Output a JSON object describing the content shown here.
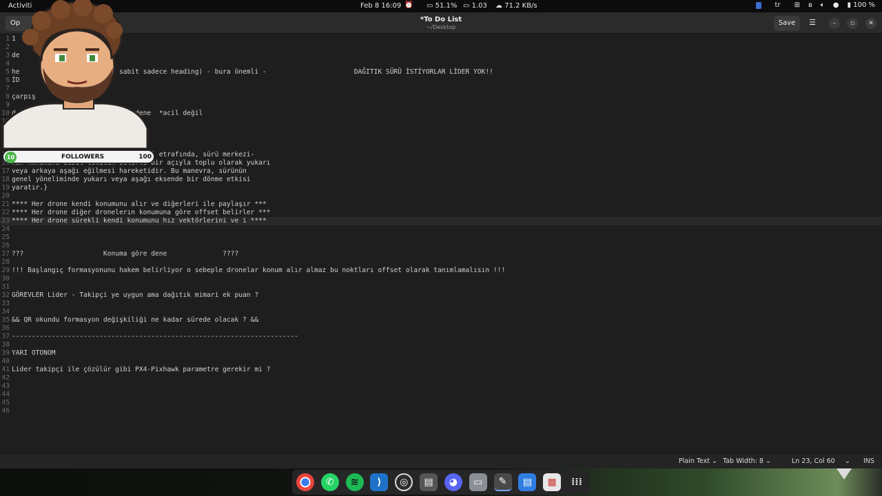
{
  "topbar": {
    "activities": "Activiti",
    "datetime": "Feb 8  16:09",
    "cpu": "51.1%",
    "load": "1.03",
    "net": "71.2 KB/s",
    "lang": "tr",
    "battery": "100 %"
  },
  "header": {
    "open_label": "Op",
    "title": "*To Do List",
    "subtitle": "~/Desktop",
    "save_label": "Save"
  },
  "overlay": {
    "followers_label": "FOLLOWERS",
    "followers_min": "10",
    "followers_max": "100"
  },
  "editor": {
    "current_line": 23,
    "lines": [
      {
        "n": "1",
        "t": "1"
      },
      {
        "n": "2",
        "t": ""
      },
      {
        "n": "3",
        "t": "de"
      },
      {
        "n": "4",
        "t": ""
      },
      {
        "n": "5",
        "t": "he                    rame sabit sadece heading) - bura önemli -                      DAĞITIK SÜRÜ İSTİYORLAR LİDER YOK!!"
      },
      {
        "n": "6",
        "t": "İD"
      },
      {
        "n": "7",
        "t": ""
      },
      {
        "n": "8",
        "t": "çarpış"
      },
      {
        "n": "9",
        "t": ""
      },
      {
        "n": "10",
        "t": "d                      kurmayı dene  *acil değil"
      },
      {
        "n": "11",
        "t": ""
      },
      {
        "n": "12",
        "t": ""
      },
      {
        "n": "13",
        "t": ""
      },
      {
        "n": "14",
        "t": ""
      },
      {
        "n": "15",
        "t": "Pitch manevrası sürünün pitch ekseni etrafında, sürü merkezi-"
      },
      {
        "n": "16",
        "t": "nin konumunu sabit tutacak belirli bir açıyla toplu olarak yukarı"
      },
      {
        "n": "17",
        "t": "veya arkaya aşağı eğilmesi hareketidir. Bu manevra, sürünün"
      },
      {
        "n": "18",
        "t": "genel yöneliminde yukarı veya aşağı eksende bir dönme etkisi"
      },
      {
        "n": "19",
        "t": "yaratır.}"
      },
      {
        "n": "20",
        "t": ""
      },
      {
        "n": "21",
        "t": "**** Her drone kendi konumunu alır ve diğerleri ile paylaşır ***"
      },
      {
        "n": "22",
        "t": "**** Her drone diğer dronelerın konumuna göre offset belirler ***"
      },
      {
        "n": "23",
        "t": "**** Her drone sürekli kendi konumunu hız vektörlerini ve i ****"
      },
      {
        "n": "24",
        "t": ""
      },
      {
        "n": "25",
        "t": ""
      },
      {
        "n": "26",
        "t": ""
      },
      {
        "n": "27",
        "t": "???                    Konuma göre dene              ????"
      },
      {
        "n": "28",
        "t": ""
      },
      {
        "n": "29",
        "t": "!!! Başlangıç formasyonunu hakem belirliyor o sebeple dronelar konum alır almaz bu noktları offset olarak tanımlamalısın !!!"
      },
      {
        "n": "30",
        "t": ""
      },
      {
        "n": "31",
        "t": ""
      },
      {
        "n": "32",
        "t": "GÖREVLER Lider - Takipçi ye uygun ama dağıtık mimari ek puan ?"
      },
      {
        "n": "33",
        "t": ""
      },
      {
        "n": "34",
        "t": ""
      },
      {
        "n": "35",
        "t": "&& QR okundu formasyon değişkiliği ne kadar sürede olacak ? &&"
      },
      {
        "n": "36",
        "t": ""
      },
      {
        "n": "37",
        "t": "------------------------------------------------------------------------"
      },
      {
        "n": "38",
        "t": ""
      },
      {
        "n": "39",
        "t": "YARI OTONOM"
      },
      {
        "n": "40",
        "t": ""
      },
      {
        "n": "41",
        "t": "Lider takipçi ile çözülür gibi PX4-Pixhawk parametre gerekir mi ?"
      },
      {
        "n": "42",
        "t": ""
      },
      {
        "n": "43",
        "t": ""
      },
      {
        "n": "44",
        "t": ""
      },
      {
        "n": "45",
        "t": ""
      },
      {
        "n": "46",
        "t": ""
      }
    ]
  },
  "statusbar": {
    "language": "Plain Text",
    "tab_width": "Tab Width: 8",
    "position": "Ln 23, Col 60",
    "mode": "INS"
  },
  "dock": {
    "apps": [
      "chrome-icon",
      "whatsapp-icon",
      "spotify-icon",
      "vscode-icon",
      "obs-icon",
      "window-icon",
      "discord-icon",
      "files-icon",
      "text-editor-icon",
      "document-icon",
      "report-icon",
      "app-grid-icon"
    ]
  }
}
